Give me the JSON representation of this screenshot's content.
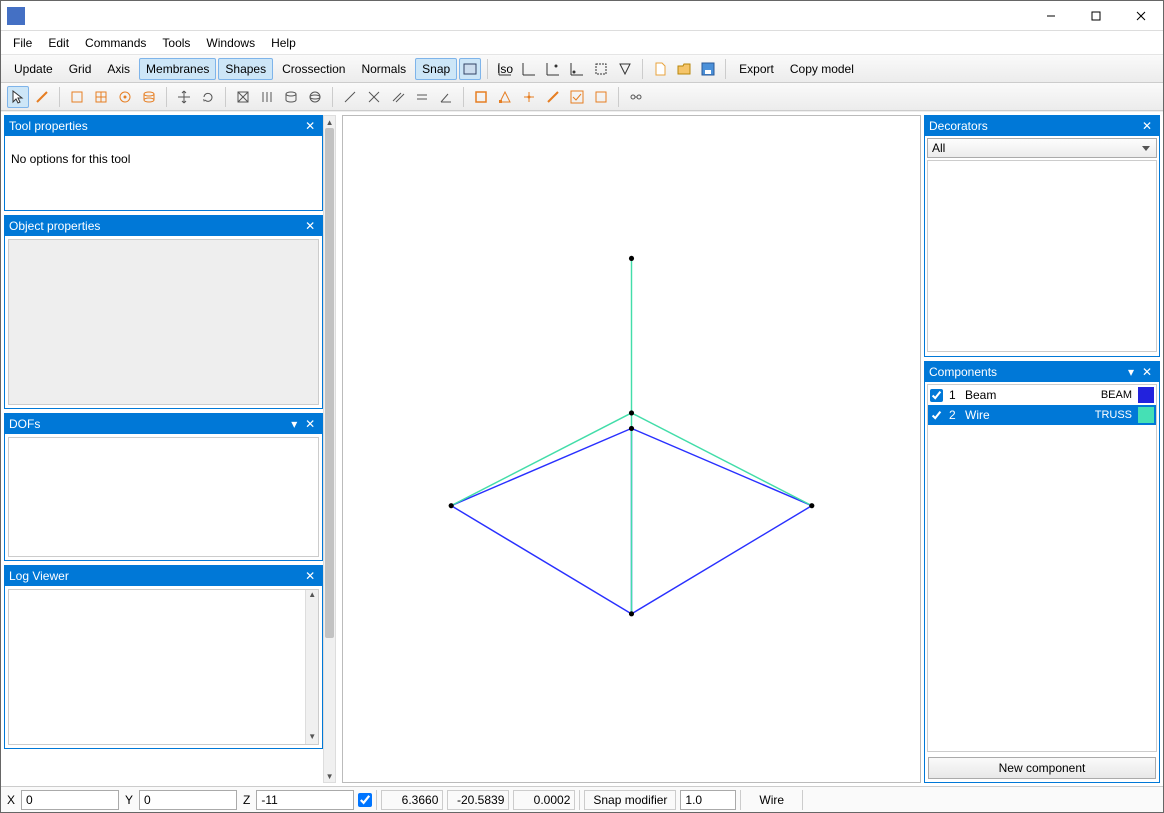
{
  "menu": {
    "file": "File",
    "edit": "Edit",
    "commands": "Commands",
    "tools": "Tools",
    "windows": "Windows",
    "help": "Help"
  },
  "toolbar1": {
    "update": "Update",
    "grid": "Grid",
    "axis": "Axis",
    "membranes": "Membranes",
    "shapes": "Shapes",
    "crossection": "Crossection",
    "normals": "Normals",
    "snap": "Snap",
    "export": "Export",
    "copy_model": "Copy model"
  },
  "panels": {
    "tool_props": {
      "title": "Tool properties",
      "msg": "No options for this tool"
    },
    "obj_props": {
      "title": "Object properties"
    },
    "dofs": {
      "title": "DOFs"
    },
    "log": {
      "title": "Log Viewer"
    },
    "decorators": {
      "title": "Decorators",
      "select": "All"
    },
    "components": {
      "title": "Components",
      "new": "New component",
      "rows": [
        {
          "num": "1",
          "name": "Beam",
          "type": "BEAM",
          "color": "#2222dd",
          "checked": true,
          "selected": false
        },
        {
          "num": "2",
          "name": "Wire",
          "type": "TRUSS",
          "color": "#45e0b5",
          "checked": true,
          "selected": true
        }
      ]
    }
  },
  "status": {
    "x_label": "X",
    "x": "0",
    "y_label": "Y",
    "y": "0",
    "z_label": "Z",
    "z": "-11",
    "v1": "6.3660",
    "v2": "-20.5839",
    "v3": "0.0002",
    "snap_label": "Snap modifier",
    "snap": "1.0",
    "material": "Wire"
  }
}
